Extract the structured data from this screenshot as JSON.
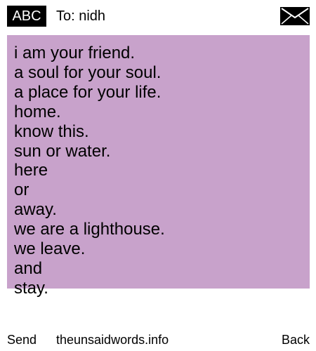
{
  "header": {
    "mode_badge": "ABC",
    "to_label": "To: nidh",
    "envelope_icon": "envelope-icon"
  },
  "message": {
    "background_color": "#c8a2cb",
    "lines": [
      "i am your friend.",
      "a soul for your soul.",
      "a place for your life.",
      "home.",
      "know this.",
      "sun or water.",
      "here",
      "or",
      "away.",
      "we are a lighthouse.",
      "we leave.",
      "and",
      "stay."
    ]
  },
  "footer": {
    "send_label": "Send",
    "site_label": "theunsaidwords.info",
    "back_label": "Back"
  }
}
